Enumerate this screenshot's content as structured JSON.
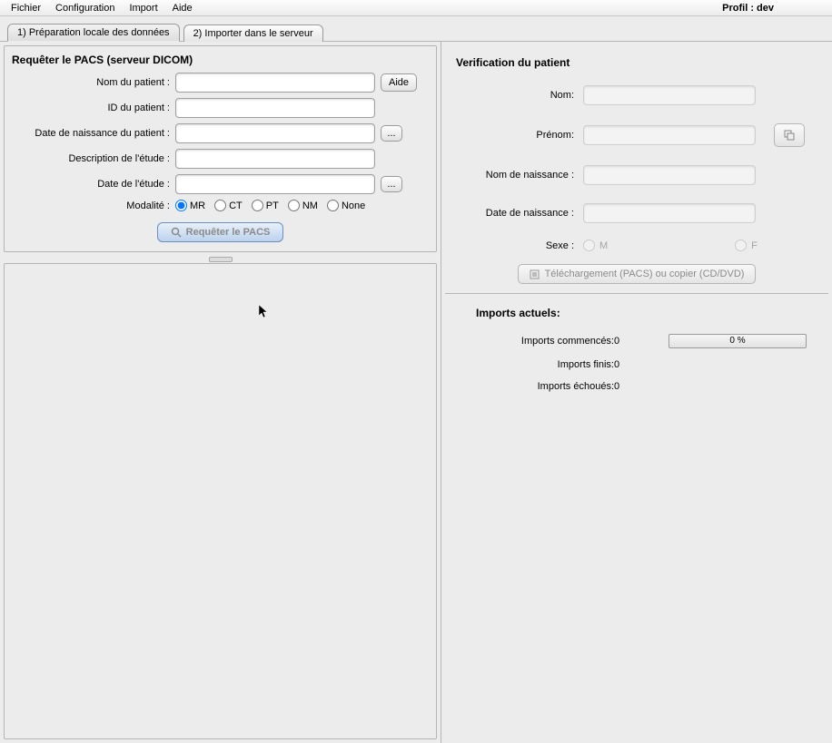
{
  "menubar": {
    "items": [
      "Fichier",
      "Configuration",
      "Import",
      "Aide"
    ],
    "profile_label": "Profil : dev"
  },
  "tabs": [
    {
      "label": "1) Préparation locale des données",
      "active": true
    },
    {
      "label": "2) Importer dans le serveur",
      "active": false
    }
  ],
  "pacs_panel": {
    "title": "Requêter le PACS (serveur DICOM)",
    "fields": {
      "patient_name_label": "Nom du patient :",
      "patient_id_label": "ID du patient :",
      "birth_date_label": "Date de naissance du patient :",
      "study_desc_label": "Description de l'étude :",
      "study_date_label": "Date de l'étude :",
      "modality_label": "Modalité :"
    },
    "help_btn": "Aide",
    "ellipsis_btn": "...",
    "modalities": [
      "MR",
      "CT",
      "PT",
      "NM",
      "None"
    ],
    "modality_selected": "MR",
    "query_btn": "Requêter le PACS"
  },
  "verification_panel": {
    "title": "Verification du patient",
    "fields": {
      "nom": "Nom:",
      "prenom": "Prénom:",
      "nom_naissance": "Nom de naissance :",
      "date_naissance": "Date de naissance :",
      "sexe": "Sexe :"
    },
    "sex_options": {
      "m": "M",
      "f": "F"
    },
    "download_btn": "Téléchargement (PACS) ou copier (CD/DVD)"
  },
  "imports_panel": {
    "title": "Imports actuels:",
    "started_label": "Imports commencés:",
    "started_value": "0",
    "finished_label": "Imports finis:",
    "finished_value": "0",
    "failed_label": "Imports échoués:",
    "failed_value": "0",
    "progress_text": "0 %"
  }
}
